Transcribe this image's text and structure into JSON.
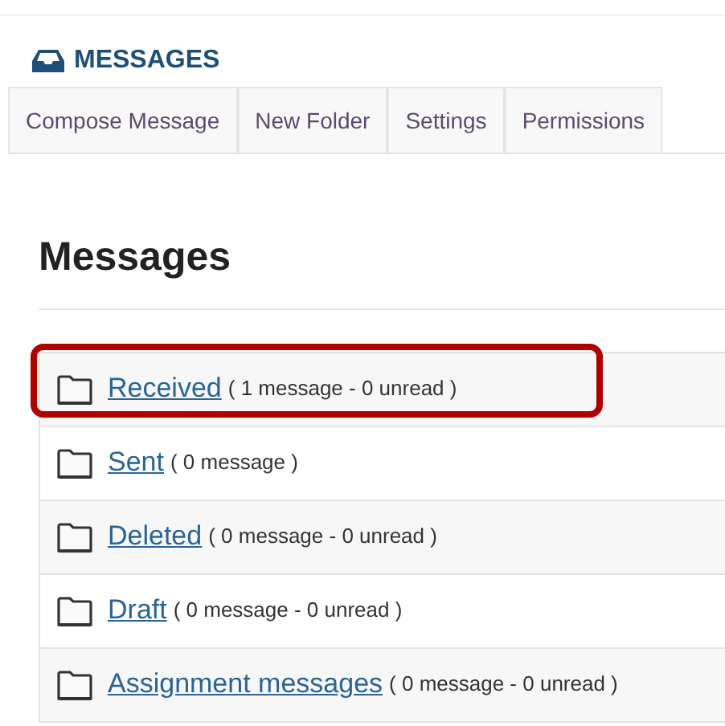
{
  "header": {
    "title": "MESSAGES"
  },
  "toolbar": [
    "Compose Message",
    "New Folder",
    "Settings",
    "Permissions"
  ],
  "heading": "Messages",
  "folders": [
    {
      "name": "Received",
      "count": "( 1 message - 0 unread )",
      "highlighted": true
    },
    {
      "name": "Sent",
      "count": "( 0 message )",
      "highlighted": false
    },
    {
      "name": "Deleted",
      "count": "( 0 message - 0 unread )",
      "highlighted": false
    },
    {
      "name": "Draft",
      "count": "( 0 message - 0 unread )",
      "highlighted": false
    },
    {
      "name": "Assignment messages",
      "count": "( 0 message - 0 unread )",
      "highlighted": false
    }
  ]
}
